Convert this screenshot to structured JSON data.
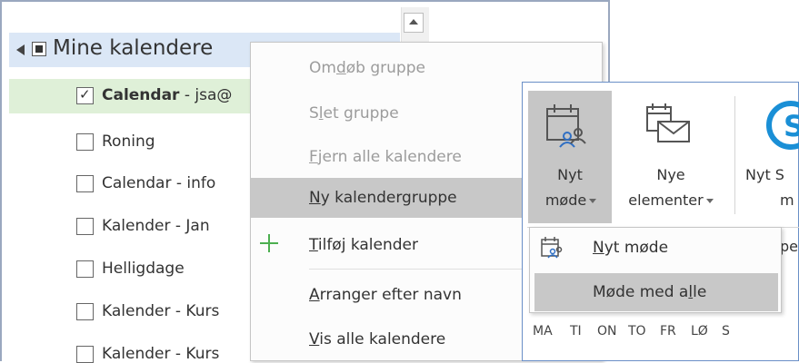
{
  "folder_pane": {
    "group_label": "Mine kalendere",
    "calendars": [
      {
        "label_bold": "Calendar",
        "label_rest": " - jsa@",
        "checked": true
      },
      {
        "label_bold": "",
        "label_rest": "Roning",
        "checked": false
      },
      {
        "label_bold": "",
        "label_rest": "Calendar - info",
        "checked": false
      },
      {
        "label_bold": "",
        "label_rest": "Kalender - Jan",
        "checked": false
      },
      {
        "label_bold": "",
        "label_rest": "Helligdage",
        "checked": false
      },
      {
        "label_bold": "",
        "label_rest": "Kalender - Kurs",
        "checked": false
      },
      {
        "label_bold": "",
        "label_rest": "Kalender - Kurs",
        "checked": false
      }
    ]
  },
  "context_menu": {
    "items": [
      {
        "pre": "Om",
        "acc": "d",
        "post": "øb gruppe",
        "enabled": false
      },
      {
        "pre": "S",
        "acc": "l",
        "post": "et gruppe",
        "enabled": false
      },
      {
        "pre": "",
        "acc": "F",
        "post": "jern alle kalendere",
        "enabled": false
      },
      {
        "pre": "",
        "acc": "N",
        "post": "y kalendergruppe",
        "enabled": true
      },
      {
        "pre": "",
        "acc": "T",
        "post": "ilføj kalender",
        "enabled": true
      },
      {
        "pre": "",
        "acc": "A",
        "post": "rranger efter navn",
        "enabled": true
      },
      {
        "pre": "",
        "acc": "V",
        "post": "is alle kalendere",
        "enabled": true
      }
    ]
  },
  "ribbon": {
    "new_meeting_line1": "Nyt",
    "new_meeting_line2": "møde",
    "new_items_line1": "Nye",
    "new_items_line2": "elementer",
    "skype_line1": "Nyt S",
    "skype_line2": "m",
    "partial_tab": "pe"
  },
  "dropdown": {
    "item1_acc": "N",
    "item1_rest": "yt møde",
    "item2_pre": "Møde med a",
    "item2_acc": "l",
    "item2_post": "le"
  },
  "days": [
    "MA",
    "TI",
    "ON",
    "TO",
    "FR",
    "LØ",
    "S"
  ]
}
